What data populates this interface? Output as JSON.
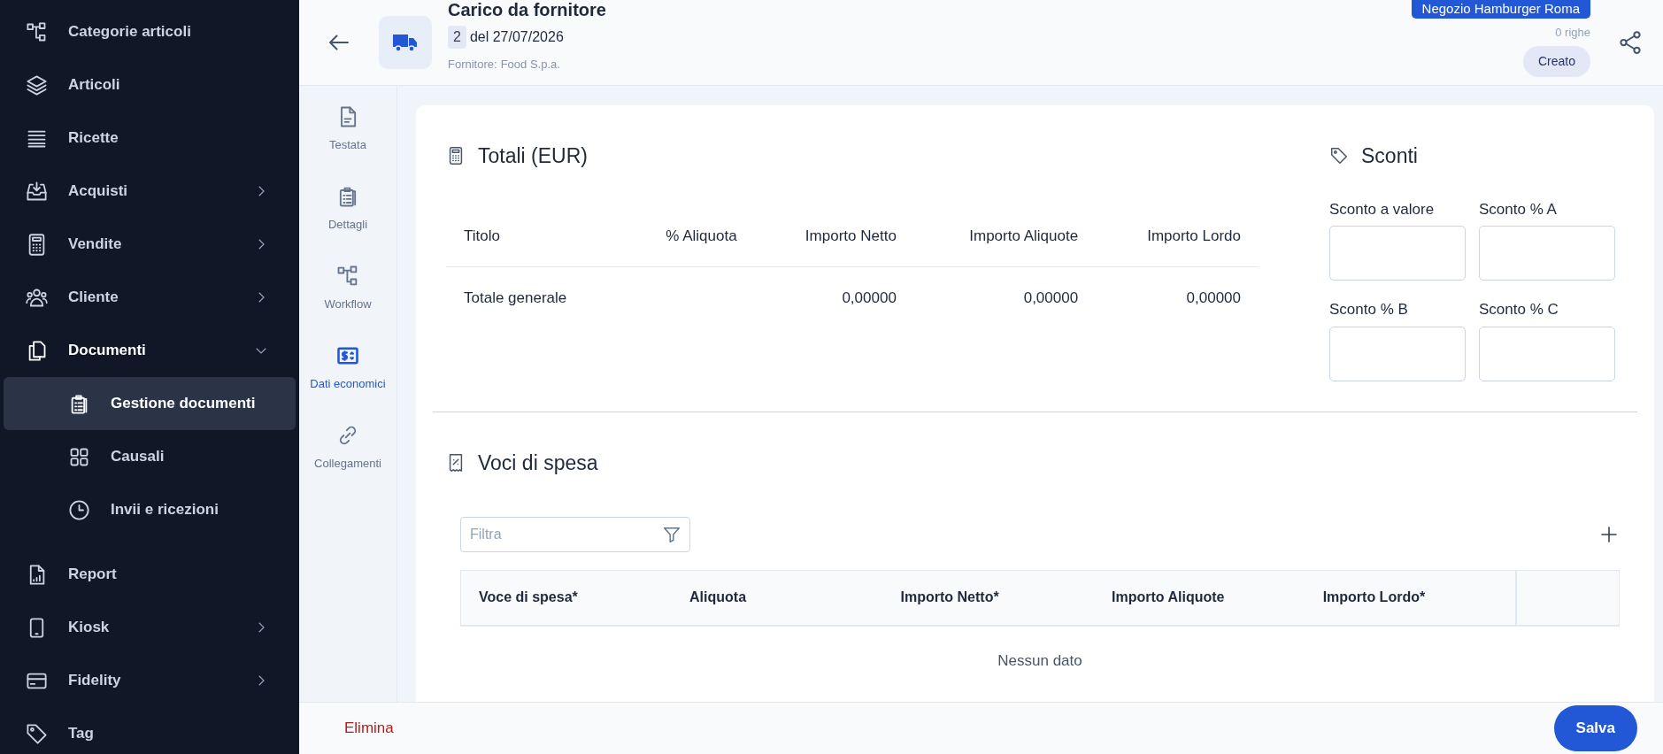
{
  "sidebar": {
    "items": [
      {
        "label": "Categorie articoli",
        "selected": false
      },
      {
        "label": "Articoli",
        "selected": false
      },
      {
        "label": "Ricette",
        "selected": false
      },
      {
        "label": "Acquisti",
        "selected": false,
        "expanded": false
      },
      {
        "label": "Vendite",
        "selected": false,
        "expanded": false
      },
      {
        "label": "Cliente",
        "selected": false,
        "expanded": false
      },
      {
        "label": "Documenti",
        "selected": false,
        "expanded": true,
        "children": [
          {
            "label": "Gestione documenti",
            "selected": true
          },
          {
            "label": "Causali",
            "selected": false
          },
          {
            "label": "Invii e ricezioni",
            "selected": false
          }
        ]
      },
      {
        "label": "Report",
        "selected": false
      },
      {
        "label": "Kiosk",
        "selected": false,
        "expanded": false
      },
      {
        "label": "Fidelity",
        "selected": false,
        "expanded": false
      },
      {
        "label": "Tag",
        "selected": false
      }
    ]
  },
  "header": {
    "title": "Carico da fornitore",
    "number": "2",
    "date": "del 27/07/2026",
    "supplier_label": "Fornitore:",
    "supplier": "Food S.p.a.",
    "store": "Negozio Hamburger Roma",
    "row_count": "0 righe",
    "status": "Creato"
  },
  "tabs": [
    {
      "label": "Testata",
      "selected": false
    },
    {
      "label": "Dettagli",
      "selected": false
    },
    {
      "label": "Workflow",
      "selected": false
    },
    {
      "label": "Dati economici",
      "selected": true
    },
    {
      "label": "Collegamenti",
      "selected": false
    }
  ],
  "totals": {
    "title": "Totali (EUR)",
    "columns": [
      "Titolo",
      "% Aliquota",
      "Importo Netto",
      "Importo Aliquote",
      "Importo Lordo"
    ],
    "rows": [
      {
        "cells": [
          "Totale generale",
          null,
          "0,00000",
          "0,00000",
          "0,00000"
        ]
      }
    ]
  },
  "discounts": {
    "title": "Sconti",
    "fields": [
      {
        "label": "Sconto a valore"
      },
      {
        "label": "Sconto % A"
      },
      {
        "label": "Sconto % B"
      },
      {
        "label": "Sconto % C"
      }
    ]
  },
  "expenses": {
    "title": "Voci di spesa",
    "filter": {
      "placeholder": "Filtra"
    },
    "columns": [
      "Voce di spesa*",
      "Aliquota",
      "Importo Netto*",
      "Importo Aliquote",
      "Importo Lordo*"
    ],
    "empty_text": "Nessun dato"
  },
  "footer": {
    "delete": "Elimina",
    "save": "Salva"
  }
}
